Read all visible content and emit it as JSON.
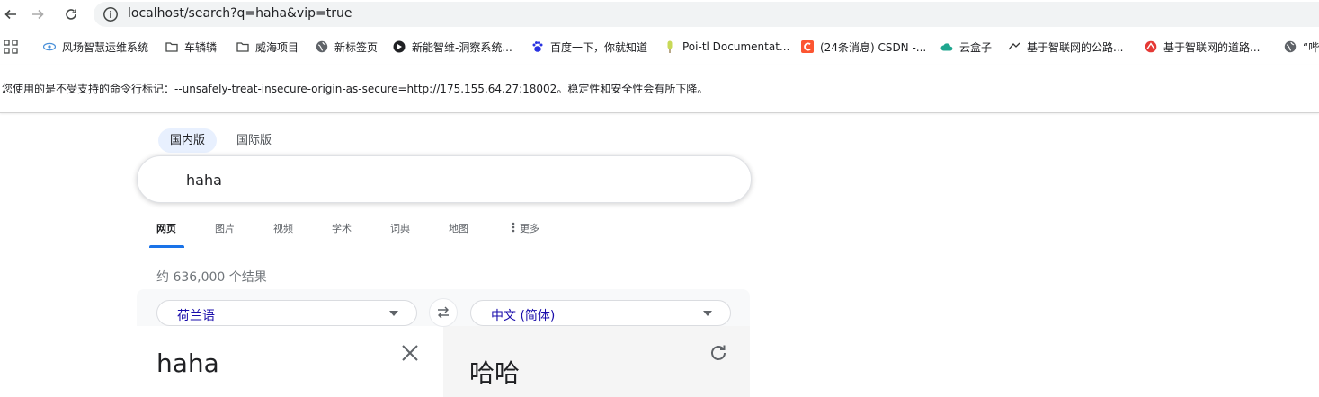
{
  "browser": {
    "url": "localhost/search?q=haha&vip=true",
    "nav_icons": [
      "back-icon",
      "forward-icon",
      "reload-icon",
      "info-icon"
    ]
  },
  "bookmarks": [
    {
      "label": "风场智慧运维系统",
      "icon": "bookmark-site-icon"
    },
    {
      "label": "车辚辚",
      "icon": "folder-icon"
    },
    {
      "label": "威海项目",
      "icon": "folder-icon"
    },
    {
      "label": "新标签页",
      "icon": "globe-icon"
    },
    {
      "label": "新能智维-洞察系统...",
      "icon": "bookmark-site-icon"
    },
    {
      "label": "百度一下，你就知道",
      "icon": "baidu-icon"
    },
    {
      "label": "Poi-tl Documentat...",
      "icon": "bookmark-site-icon"
    },
    {
      "label": "(24条消息) CSDN -...",
      "icon": "csdn-icon"
    },
    {
      "label": "云盒子",
      "icon": "cloud-icon"
    },
    {
      "label": "基于智联网的公路...",
      "icon": "bookmark-site-icon"
    },
    {
      "label": "基于智联网的道路...",
      "icon": "bookmark-site-icon"
    },
    {
      "label": "“哔",
      "icon": "globe-icon"
    }
  ],
  "infobar": {
    "message": "您使用的是不受支持的命令行标记：--unsafely-treat-insecure-origin-as-secure=http://175.155.64.27:18002。稳定性和安全性会有所下降。"
  },
  "region_tabs": [
    {
      "label": "国内版",
      "active": true
    },
    {
      "label": "国际版",
      "active": false
    }
  ],
  "search": {
    "query": "haha"
  },
  "vertical_tabs": [
    {
      "label": "网页",
      "active": true
    },
    {
      "label": "图片"
    },
    {
      "label": "视频"
    },
    {
      "label": "学术"
    },
    {
      "label": "词典"
    },
    {
      "label": "地图"
    },
    {
      "label": "更多",
      "icon": "more-vert-icon"
    }
  ],
  "results": {
    "stats": "约 636,000 个结果"
  },
  "translate": {
    "source_lang": "荷兰语",
    "target_lang": "中文 (简体)",
    "source_text": "haha",
    "target_text": "哈哈"
  },
  "colors": {
    "accent": "#1a73e8",
    "link": "#1a0dab",
    "omnibox_bg": "#f1f3f4",
    "active_region_bg": "#e8f0fe"
  }
}
